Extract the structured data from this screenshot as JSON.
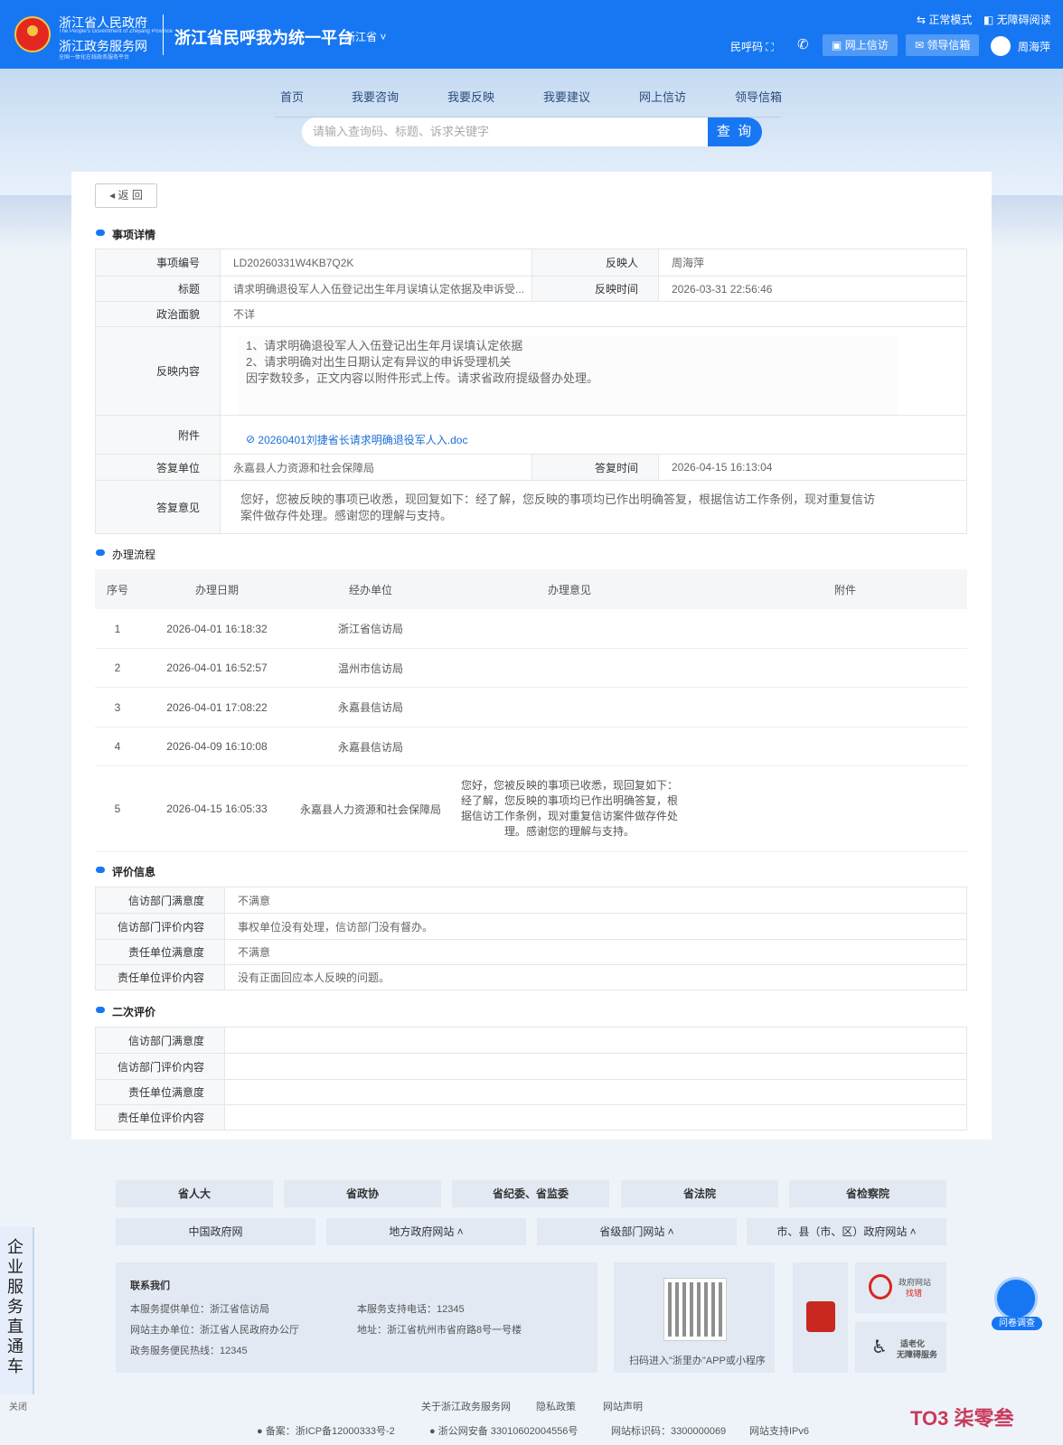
{
  "header": {
    "org1": "浙江省人民政府",
    "org1_sub": "The People's Government of Zhejiang Province",
    "org2": "浙江政务服务网",
    "org2_sub": "全国一体化在线政务服务平台",
    "platform": "浙江省民呼我为统一平台",
    "province": "浙江省 ˅",
    "mode_normal": "⇆ 正常模式",
    "mode_access": "◧ 无障碍阅读",
    "minhu": "民呼码",
    "btn_online": "网上信访",
    "btn_leader": "领导信箱",
    "user": "周海萍"
  },
  "nav": {
    "items": [
      "首页",
      "我要咨询",
      "我要反映",
      "我要建议",
      "网上信访",
      "领导信箱"
    ]
  },
  "search": {
    "placeholder": "请输入查询码、标题、诉求关键字",
    "button": "查 询"
  },
  "back": "返 回",
  "detail": {
    "section": "事项详情",
    "labels": {
      "id": "事项编号",
      "reporter": "反映人",
      "title": "标题",
      "time": "反映时间",
      "political": "政治面貌",
      "content": "反映内容",
      "attachment": "附件",
      "unit": "答复单位",
      "reply_time": "答复时间",
      "opinion": "答复意见"
    },
    "id": "LD20260331W4KB7Q2K",
    "reporter": "周海萍",
    "title": "请求明确退役军人入伍登记出生年月误填认定依据及申诉受...",
    "time": "2026-03-31 22:56:46",
    "political": "不详",
    "content": [
      "1、请求明确退役军人入伍登记出生年月误填认定依据",
      "2、请求明确对出生日期认定有异议的申诉受理机关",
      "因字数较多，正文内容以附件形式上传。请求省政府提级督办处理。"
    ],
    "attachment": "20260401刘捷省长请求明确退役军人入.doc",
    "unit": "永嘉县人力资源和社会保障局",
    "reply_time": "2026-04-15 16:13:04",
    "opinion": [
      "您好，您被反映的事项已收悉，现回复如下：经了解，您反映的事项均已作出明确答复，根据信访工作条例，现对重复信访",
      "案件做存件处理。感谢您的理解与支持。"
    ]
  },
  "flow": {
    "section": "办理流程",
    "headers": [
      "序号",
      "办理日期",
      "经办单位",
      "办理意见",
      "附件"
    ],
    "rows": [
      {
        "no": "1",
        "date": "2026-04-01 16:18:32",
        "unit": "浙江省信访局",
        "opinion": ""
      },
      {
        "no": "2",
        "date": "2026-04-01 16:52:57",
        "unit": "温州市信访局",
        "opinion": ""
      },
      {
        "no": "3",
        "date": "2026-04-01 17:08:22",
        "unit": "永嘉县信访局",
        "opinion": ""
      },
      {
        "no": "4",
        "date": "2026-04-09 16:10:08",
        "unit": "永嘉县信访局",
        "opinion": ""
      },
      {
        "no": "5",
        "date": "2026-04-15 16:05:33",
        "unit": "永嘉县人力资源和社会保障局",
        "opinion": [
          "您好，您被反映的事项已收悉，现回复如下：",
          "经了解，您反映的事项均已作出明确答复，根",
          "据信访工作条例，现对重复信访案件做存件处",
          "理。感谢您的理解与支持。"
        ]
      }
    ]
  },
  "eval": {
    "section": "评价信息",
    "rows": [
      {
        "label": "信访部门满意度",
        "value": "不满意"
      },
      {
        "label": "信访部门评价内容",
        "value": "事权单位没有处理，信访部门没有督办。"
      },
      {
        "label": "责任单位满意度",
        "value": "不满意"
      },
      {
        "label": "责任单位评价内容",
        "value": "没有正面回应本人反映的问题。"
      }
    ]
  },
  "eval2": {
    "section": "二次评价",
    "rows": [
      {
        "label": "信访部门满意度",
        "value": ""
      },
      {
        "label": "信访部门评价内容",
        "value": ""
      },
      {
        "label": "责任单位满意度",
        "value": ""
      },
      {
        "label": "责任单位评价内容",
        "value": ""
      }
    ]
  },
  "footer": {
    "links1": [
      "省人大",
      "省政协",
      "省纪委、省监委",
      "省法院",
      "省检察院"
    ],
    "links2": [
      "中国政府网",
      "地方政府网站 ˄",
      "省级部门网站 ˄",
      "市、县（市、区）政府网站 ˄"
    ],
    "contact_title": "联系我们",
    "provider": "本服务提供单位：浙江省信访局",
    "phone": "本服务支持电话：12345",
    "host": "网站主办单位：浙江省人民政府办公厅",
    "address": "地址：浙江省杭州市省府路8号一号楼",
    "hotline": "政务服务便民热线：12345",
    "qr_text": "扫码进入\"浙里办\"APP或小程序",
    "badge1": "政府网站",
    "badge1b": "找错",
    "badge2": "适老化",
    "badge2b": "无障碍服务",
    "bottom": [
      "关于浙江政务服务网",
      "隐私政策",
      "网站声明"
    ],
    "icp": "备案：浙ICP备12000333号-2",
    "police": "浙公网安备 33010602004556号",
    "siteid": "网站标识码：3300000069",
    "ipv6": "网站支持IPv6"
  },
  "side": {
    "label": "企业服务直通车",
    "close": "关闭"
  },
  "survey": "问卷调查",
  "watermark": "TO3 柒零叁"
}
